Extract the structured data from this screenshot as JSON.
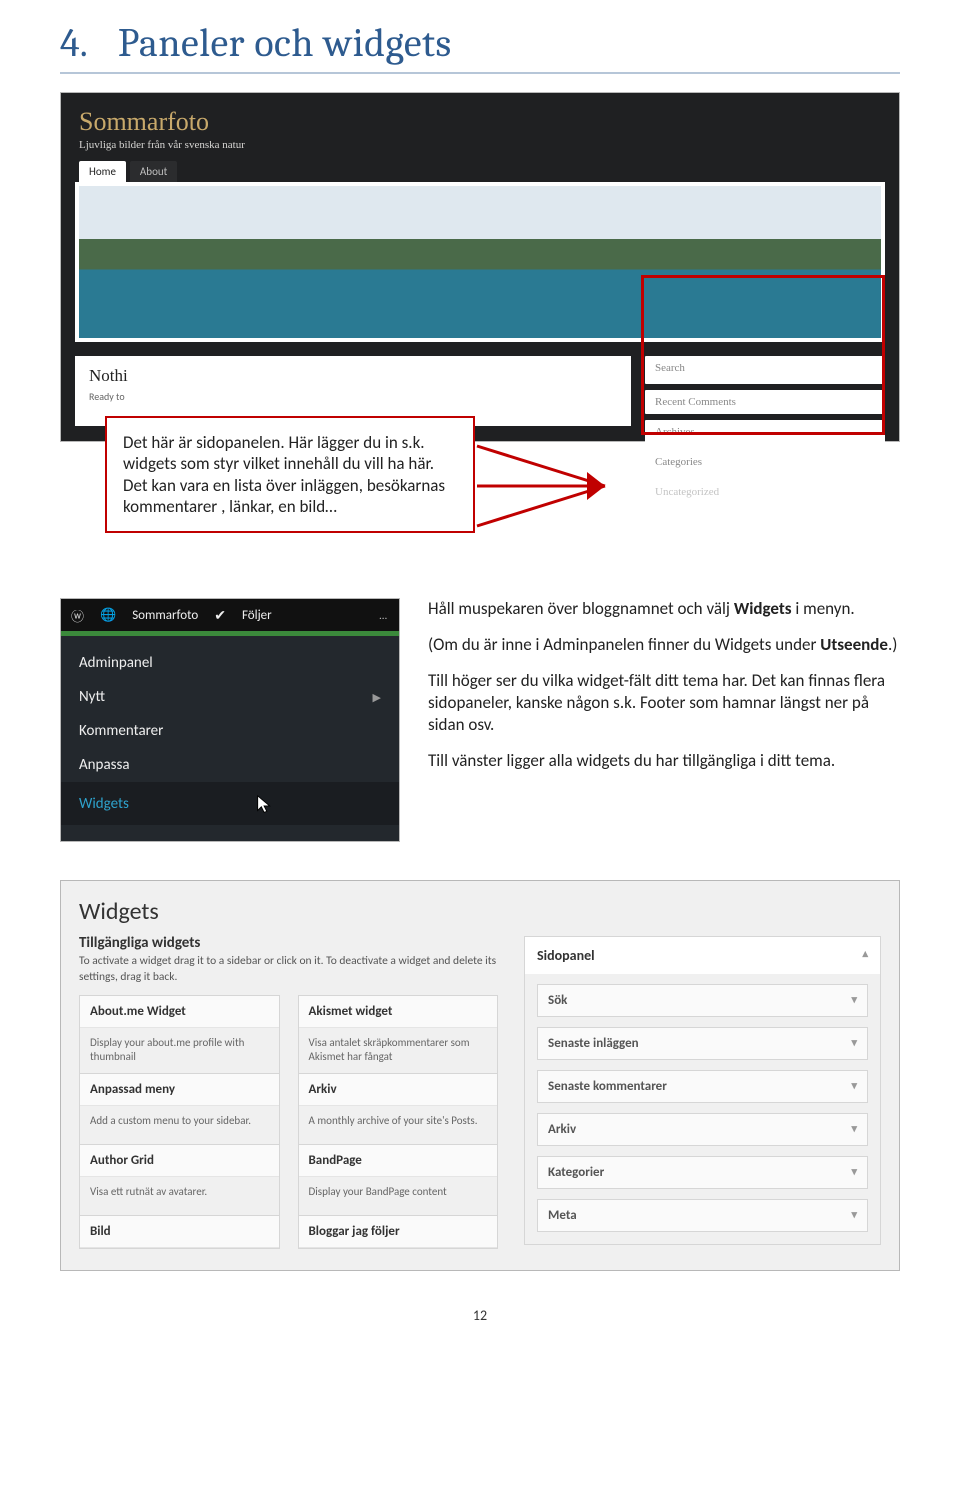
{
  "heading": {
    "number": "4.",
    "title": "Paneler och widgets"
  },
  "blog": {
    "title": "Sommarfoto",
    "tagline": "Ljuvliga bilder från vår svenska natur",
    "tabs": [
      "Home",
      "About"
    ],
    "main_heading": "Nothi",
    "main_sub": "Ready to",
    "sidebar_items": [
      "Search",
      "Recent Comments",
      "Archives",
      "Categories",
      "Uncategorized"
    ]
  },
  "callout": "Det här är sidopanelen. Här lägger du in s.k. widgets som styr vilket innehåll du vill ha här. Det kan vara en lista över inläggen, besökarnas kommentarer , länkar, en bild…",
  "admin": {
    "site": "Sommarfoto",
    "following": "Följer",
    "items": [
      "Adminpanel",
      "Nytt",
      "Kommentarer",
      "Anpassa",
      "Widgets"
    ]
  },
  "para": {
    "p1a": "Håll muspekaren över bloggnamnet och välj ",
    "p1b": "Widgets",
    "p1c": " i menyn.",
    "p2a": "(Om du är inne i Adminpanelen finner du Widgets under ",
    "p2b": "Utseende",
    "p2c": ".)",
    "p3": "Till höger ser du vilka widget-fält ditt tema har. Det kan finnas flera sidopaneler, kanske någon s.k. Footer som hamnar längst ner på sidan osv.",
    "p4": "Till vänster ligger alla widgets du har tillgängliga i ditt tema."
  },
  "widgets_panel": {
    "title": "Widgets",
    "subtitle": "Tillgängliga widgets",
    "help": "To activate a widget drag it to a sidebar or click on it. To deactivate a widget and delete its settings, drag it back.",
    "available": [
      {
        "name": "About.me Widget",
        "desc": "Display your about.me profile with thumbnail"
      },
      {
        "name": "Akismet widget",
        "desc": "Visa antalet skräpkommentarer som Akismet har fångat"
      },
      {
        "name": "Anpassad meny",
        "desc": "Add a custom menu to your sidebar."
      },
      {
        "name": "Arkiv",
        "desc": "A monthly archive of your site's Posts."
      },
      {
        "name": "Author Grid",
        "desc": "Visa ett rutnät av avatarer."
      },
      {
        "name": "BandPage",
        "desc": "Display your BandPage content"
      },
      {
        "name": "Bild",
        "desc": ""
      },
      {
        "name": "Bloggar jag följer",
        "desc": ""
      }
    ],
    "sidebar_name": "Sidopanel",
    "sidebar_items": [
      "Sök",
      "Senaste inläggen",
      "Senaste kommentarer",
      "Arkiv",
      "Kategorier",
      "Meta"
    ]
  },
  "page_number": "12"
}
